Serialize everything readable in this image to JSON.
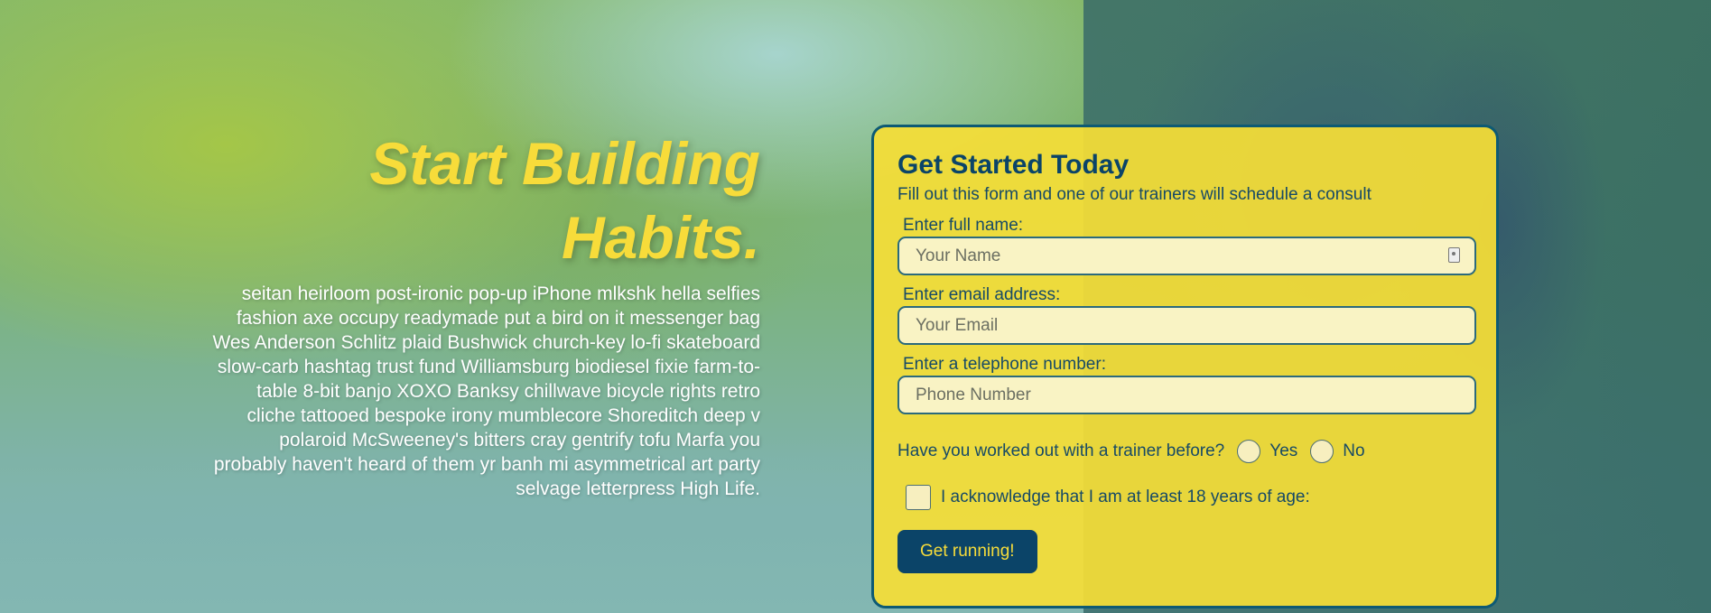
{
  "hero": {
    "headline_line1": "Start Building",
    "headline_line2": "Habits.",
    "body": "seitan heirloom post-ironic pop-up iPhone mlkshk hella selfies fashion axe occupy readymade put a bird on it messenger bag Wes Anderson Schlitz plaid Bushwick church-key lo-fi skateboard slow-carb hashtag trust fund Williamsburg biodiesel fixie farm-to-table 8-bit banjo XOXO Banksy chillwave bicycle rights retro cliche tattooed bespoke irony mumblecore Shoreditch deep v polaroid McSweeney's bitters cray gentrify tofu Marfa you probably haven't heard of them yr banh mi asymmetrical art party selvage letterpress High Life."
  },
  "form": {
    "title": "Get Started Today",
    "subtitle": "Fill out this form and one of our trainers will schedule a consult",
    "name": {
      "label": "Enter full name:",
      "placeholder": "Your Name",
      "icon": "contact-card-icon"
    },
    "email": {
      "label": "Enter email address:",
      "placeholder": "Your Email"
    },
    "phone": {
      "label": "Enter a telephone number:",
      "placeholder": "Phone Number"
    },
    "trainer_question": "Have you worked out with a trainer before?",
    "option_yes": "Yes",
    "option_no": "No",
    "age_ack": "I acknowledge that I am at least 18 years of age:",
    "submit_label": "Get running!"
  },
  "colors": {
    "accent_yellow": "#f7dc3a",
    "navy": "#0b4468"
  }
}
